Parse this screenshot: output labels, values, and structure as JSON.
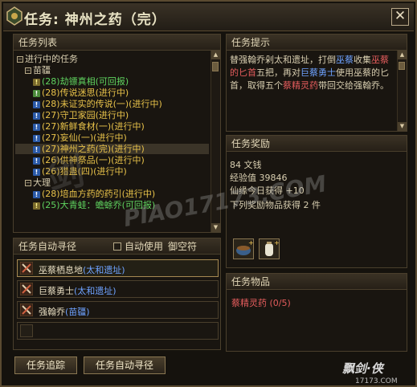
{
  "window": {
    "title": "任务: 神州之药（完）",
    "close_label": "✕"
  },
  "quest_list": {
    "header": "任务列表",
    "root_label": "进行中的任务",
    "groups": [
      {
        "label": "苗疆",
        "quests": [
          {
            "text": "(28)劫镖真相(可回报)",
            "color": "green",
            "icon": "done"
          },
          {
            "text": "(28)传说迷思(进行中)",
            "color": "yellow",
            "icon": "pending"
          },
          {
            "text": "(28)未证实的传说(一)(进行中)",
            "color": "yellow",
            "icon": "active"
          },
          {
            "text": "(27)守卫家园(进行中)",
            "color": "yellow",
            "icon": "active"
          },
          {
            "text": "(27)新鲜食材(一)(进行中)",
            "color": "yellow",
            "icon": "active"
          },
          {
            "text": "(27)妄仙(一)(进行中)",
            "color": "yellow",
            "icon": "active"
          },
          {
            "text": "(27)神州之药(完)(进行中)",
            "color": "yellow",
            "icon": "active",
            "selected": true
          },
          {
            "text": "(26)供神祭品(一)(进行中)",
            "color": "yellow",
            "icon": "active"
          },
          {
            "text": "(26)猎蛊(四)(进行中)",
            "color": "yellow",
            "icon": "active"
          }
        ]
      },
      {
        "label": "大理",
        "quests": [
          {
            "text": "(28)培血方药的药引(进行中)",
            "color": "yellow",
            "icon": "active"
          },
          {
            "text": "(25)大青蛙：蟾蜍乔(可回报)",
            "color": "green",
            "icon": "done"
          }
        ]
      }
    ]
  },
  "auto_path": {
    "header": "任务自动寻径",
    "auto_use_label": "自动使用",
    "item_label": "御空符",
    "locations": [
      {
        "name": "巫蔡栖息地",
        "region": "(太和遗址)"
      },
      {
        "name": "巨蔡勇士",
        "region": "(太和遗址)"
      },
      {
        "name": "强翰乔",
        "region": "(苗疆)"
      },
      {
        "name": "",
        "region": ""
      }
    ]
  },
  "buttons": {
    "track": "任务追踪",
    "auto_path": "任务自动寻径"
  },
  "hint": {
    "header": "任务提示",
    "segments": [
      {
        "t": "替强翰乔剁太和遗址，打倒",
        "c": ""
      },
      {
        "t": "巫蔡",
        "c": "b"
      },
      {
        "t": "收集",
        "c": ""
      },
      {
        "t": "巫蔡的匕首",
        "c": "r"
      },
      {
        "t": "五把，再对",
        "c": ""
      },
      {
        "t": "巨蔡勇士",
        "c": "b"
      },
      {
        "t": "使用巫蔡的匕首，取得五个",
        "c": ""
      },
      {
        "t": "蔡精灵药",
        "c": "r"
      },
      {
        "t": "带回交给强翰乔。",
        "c": ""
      }
    ]
  },
  "reward": {
    "header": "任务奖励",
    "money": "84 文钱",
    "exp": "经验值 39846",
    "xian": "仙缘今日获得 +10",
    "items_line": "下列奖励物品获得 2 件"
  },
  "items": {
    "header": "任务物品",
    "entry": "蔡精灵药 (0/5)"
  },
  "watermark": {
    "game": "剑",
    "site": "PIAO17173.COM",
    "brand": "17173.COM",
    "corner_logo": "飘剑·侠"
  }
}
